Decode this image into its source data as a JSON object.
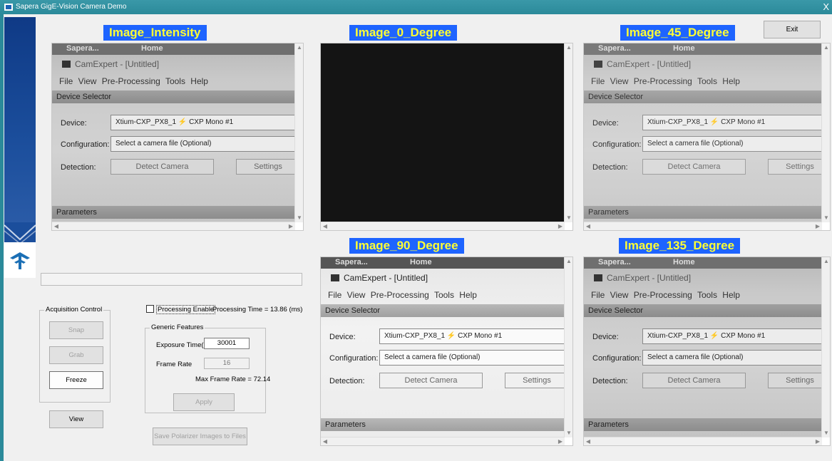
{
  "window": {
    "title": "Sapera GigE-Vision Camera Demo",
    "close_glyph": "X"
  },
  "labels": {
    "intensity": "Image_Intensity",
    "deg0": "Image_0_Degree",
    "deg45": "Image_45_Degree",
    "deg90": "Image_90_Degree",
    "deg135": "Image_135_Degree"
  },
  "exit_button": "Exit",
  "acquisition": {
    "group_title": "Acquisition Control",
    "snap": "Snap",
    "grab": "Grab",
    "freeze": "Freeze",
    "view": "View"
  },
  "processing": {
    "enable_label": "Processing Enable",
    "enabled": false,
    "time_text": "Processing Time = 13.86 (ms)"
  },
  "generic": {
    "group_title": "Generic Features",
    "exposure_label": "Exposure Time(us)",
    "exposure_value": "30001",
    "frame_rate_label": "Frame Rate",
    "frame_rate_value": "16",
    "max_frame_rate": "Max Frame Rate = 72.14",
    "apply": "Apply"
  },
  "save_button": "Save Polarizer Images to Files",
  "snapshot": {
    "strip_left": "Sapera...",
    "strip_right": "Home",
    "app_title": "CamExpert - [Untitled]",
    "menu": "File  View  Pre-Processing  Tools  Help",
    "device_selector": "Device Selector",
    "device_label": "Device:",
    "device_value": "Xtium-CXP_PX8_1",
    "device_value2": "CXP Mono #1",
    "config_label": "Configuration:",
    "config_value": "Select a camera file (Optional)",
    "detection_label": "Detection:",
    "detect_button": "Detect Camera",
    "settings_button": "Settings",
    "parameters": "Parameters"
  },
  "colors": {
    "label_bg": "#1e64ff",
    "label_fg": "#ffff33",
    "titlebar": "#2b8a9a",
    "sidebar": "#1b4e9c"
  }
}
